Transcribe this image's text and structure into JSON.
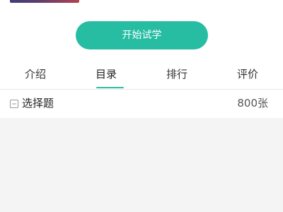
{
  "course": {
    "start_button_label": "开始试学"
  },
  "tabs": [
    {
      "label": "介绍",
      "active": false
    },
    {
      "label": "目录",
      "active": true
    },
    {
      "label": "排行",
      "active": false
    },
    {
      "label": "评价",
      "active": false
    }
  ],
  "catalog": {
    "section_title": "选择题",
    "section_count": "800张"
  },
  "colors": {
    "accent": "#26bda3",
    "background": "#f4f4f4",
    "surface": "#ffffff"
  }
}
